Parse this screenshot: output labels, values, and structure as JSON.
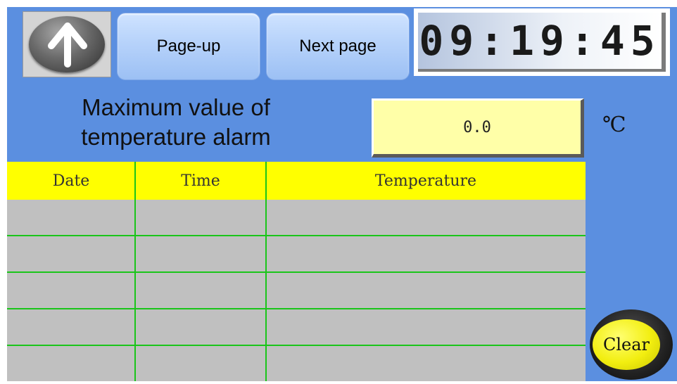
{
  "toolbar": {
    "up_icon": "up-arrow-icon",
    "page_up_label": "Page-up",
    "next_page_label": "Next page",
    "clock": "09:19:45"
  },
  "alarm": {
    "label_line1": "Maximum value of",
    "label_line2": "temperature alarm",
    "value": "0.0",
    "unit": "℃"
  },
  "table": {
    "columns": [
      "Date",
      "Time",
      "Temperature"
    ],
    "rows": [
      [
        "",
        "",
        ""
      ],
      [
        "",
        "",
        ""
      ],
      [
        "",
        "",
        ""
      ],
      [
        "",
        "",
        ""
      ],
      [
        "",
        "",
        ""
      ]
    ]
  },
  "actions": {
    "clear_label": "Clear"
  },
  "colors": {
    "panel_bg": "#5b8fe0",
    "header_bg": "#ffff00",
    "grid_line": "#1ac51a",
    "table_body": "#c0c0c0",
    "value_box": "#ffffa8"
  }
}
